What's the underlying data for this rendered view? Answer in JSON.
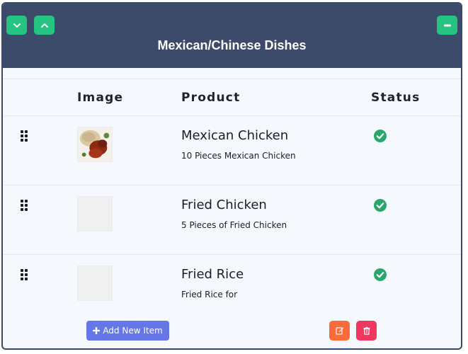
{
  "panel": {
    "title": "Mexican/Chinese Dishes",
    "buttons": {
      "expand_icon": "chevron-down-icon",
      "collapse_icon": "chevron-up-icon",
      "minimize_icon": "minus-icon"
    },
    "colors": {
      "header_bg": "#3d4b6b",
      "accent_green": "#27c383"
    }
  },
  "table": {
    "columns": [
      "Image",
      "Product",
      "Status"
    ],
    "rows": [
      {
        "name": "Mexican Chicken",
        "description": "10 Pieces Mexican Chicken",
        "has_image": true,
        "status": "active"
      },
      {
        "name": "Fried Chicken",
        "description": "5 Pieces of Fried Chicken",
        "has_image": false,
        "status": "active"
      },
      {
        "name": "Fried Rice",
        "description": "Fried Rice for",
        "has_image": false,
        "status": "active"
      }
    ]
  },
  "footer": {
    "add_label": "Add New Item",
    "add_icon": "plus-icon",
    "edit_icon": "edit-icon",
    "delete_icon": "trash-icon",
    "colors": {
      "add": "#6576e9",
      "edit": "#ff6a3d",
      "delete": "#f0385f"
    }
  }
}
